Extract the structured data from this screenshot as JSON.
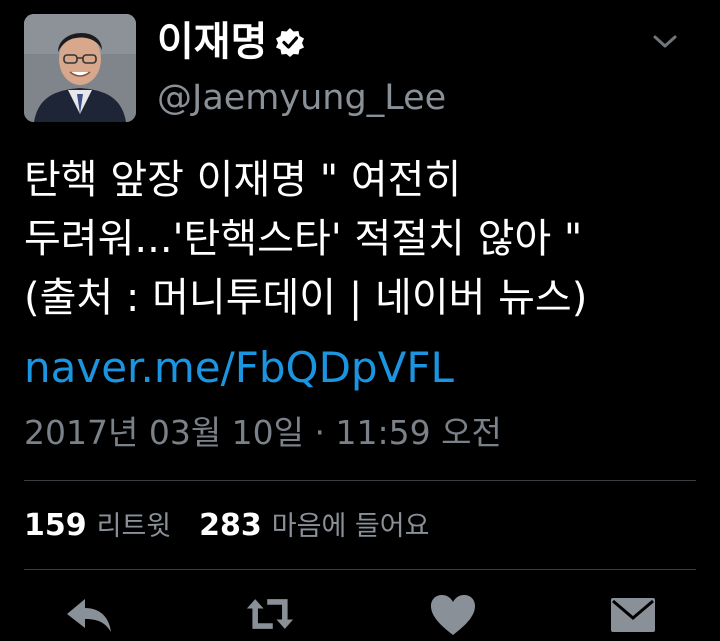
{
  "profile": {
    "display_name": "이재명",
    "handle": "@Jaemyung_Lee"
  },
  "tweet": {
    "text": "탄핵 앞장 이재명  \" 여전히\n두려워...'탄핵스타' 적절치 않아 \"\n(출처 : 머니투데이 | 네이버 뉴스)",
    "link": "naver.me/FbQDpVFL",
    "timestamp": "2017년 03월 10일 · 11:59 오전"
  },
  "stats": [
    {
      "count": "159",
      "label": "리트윗"
    },
    {
      "count": "283",
      "label": "마음에 들어요"
    }
  ],
  "icons": {
    "verified": "verified-badge-icon",
    "menu": "chevron-down-icon",
    "reply": "reply-icon",
    "retweet": "retweet-icon",
    "like": "heart-icon",
    "dm": "envelope-icon"
  },
  "colors": {
    "background": "#000000",
    "link": "#1b95e0",
    "secondary_text": "#8a9097",
    "icon": "#8a9097"
  }
}
